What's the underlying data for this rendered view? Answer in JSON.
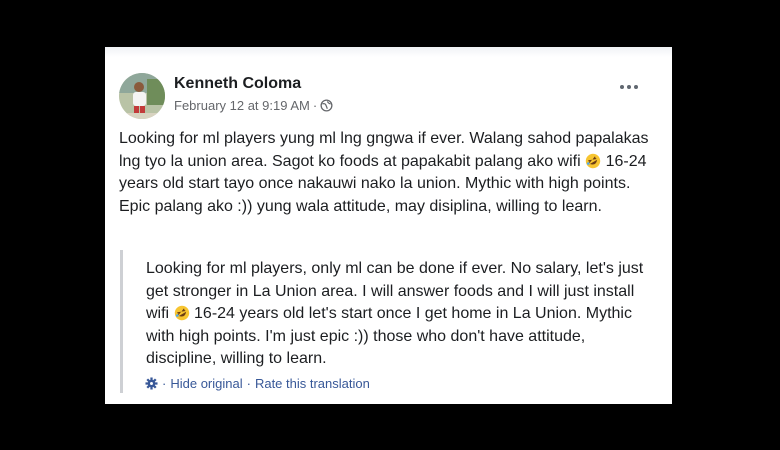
{
  "post": {
    "author": "Kenneth Coloma",
    "date": "February 12 at 9:19 AM",
    "meta_separator": "·",
    "privacy_icon": "globe-icon",
    "more_icon": "more-options-icon",
    "text_part1": "Looking for ml players yung ml lng gngwa if ever. Walang sahod papalakas lng tyo la union area. Sagot ko foods at papakabit palang ako wifi",
    "text_emoji": "rolling-on-floor-laughing-emoji",
    "text_part2": " 16-24 years old start tayo once nakauwi nako la union. Mythic with high points. Epic palang ako :)) yung wala attitude, may disiplina, willing to learn."
  },
  "translation": {
    "text_part1": "Looking for ml players, only ml can be done if ever. No salary, let's just get stronger in La Union area. I will answer foods and I will just install wifi",
    "text_emoji": "rolling-on-floor-laughing-emoji",
    "text_part2": " 16-24 years old let's start once I get home in La Union. Mythic with high points. I'm just epic :)) those who don't have attitude, discipline, willing to learn.",
    "gear_icon": "gear-icon",
    "hide_label": "Hide original",
    "separator": "·",
    "rate_label": "Rate this translation"
  },
  "colors": {
    "background": "#000000",
    "card": "#ffffff",
    "link": "#385898",
    "meta": "#65676b",
    "quote_border": "#ced0d4"
  }
}
